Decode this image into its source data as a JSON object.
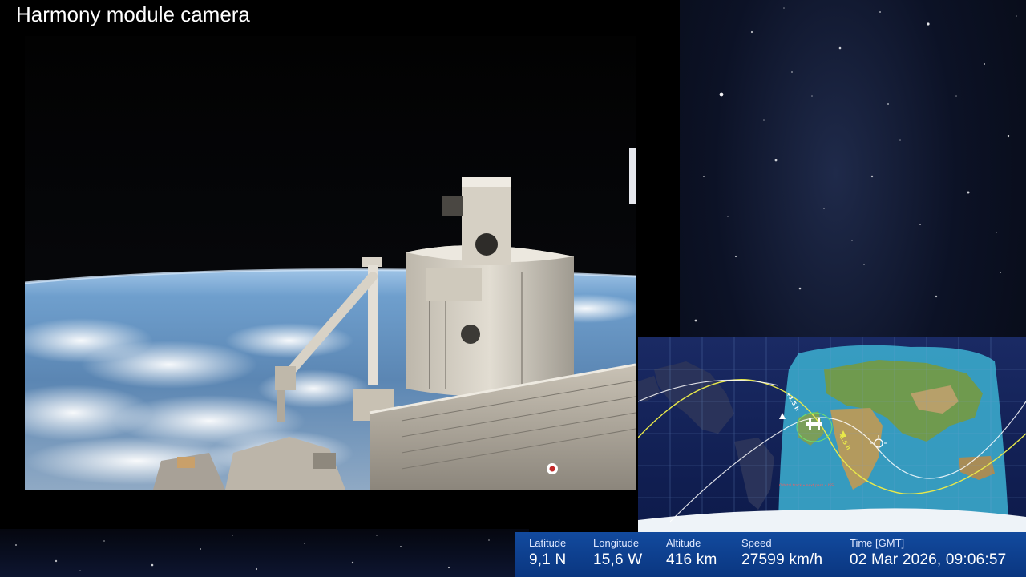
{
  "title": "Harmony module camera",
  "telemetry": {
    "latitude": {
      "label": "Latitude",
      "value": "9,1 N"
    },
    "longitude": {
      "label": "Longitude",
      "value": "15,6 W"
    },
    "altitude": {
      "label": "Altitude",
      "value": "416 km"
    },
    "speed": {
      "label": "Speed",
      "value": "27599 km/h"
    },
    "time": {
      "label": "Time [GMT]",
      "value": "02 Mar 2026, 09:06:57"
    }
  },
  "map": {
    "track_label_before": "+1.5 h",
    "track_label_after": "-1.5 h",
    "day_color": "#3aa6c9",
    "night_color": "#0d1a4a",
    "track_ahead_color": "#e8e84a",
    "track_behind_color": "#ffffff"
  },
  "colors": {
    "telemetry_bg": "#0b3d8f",
    "title_text": "#ffffff"
  }
}
